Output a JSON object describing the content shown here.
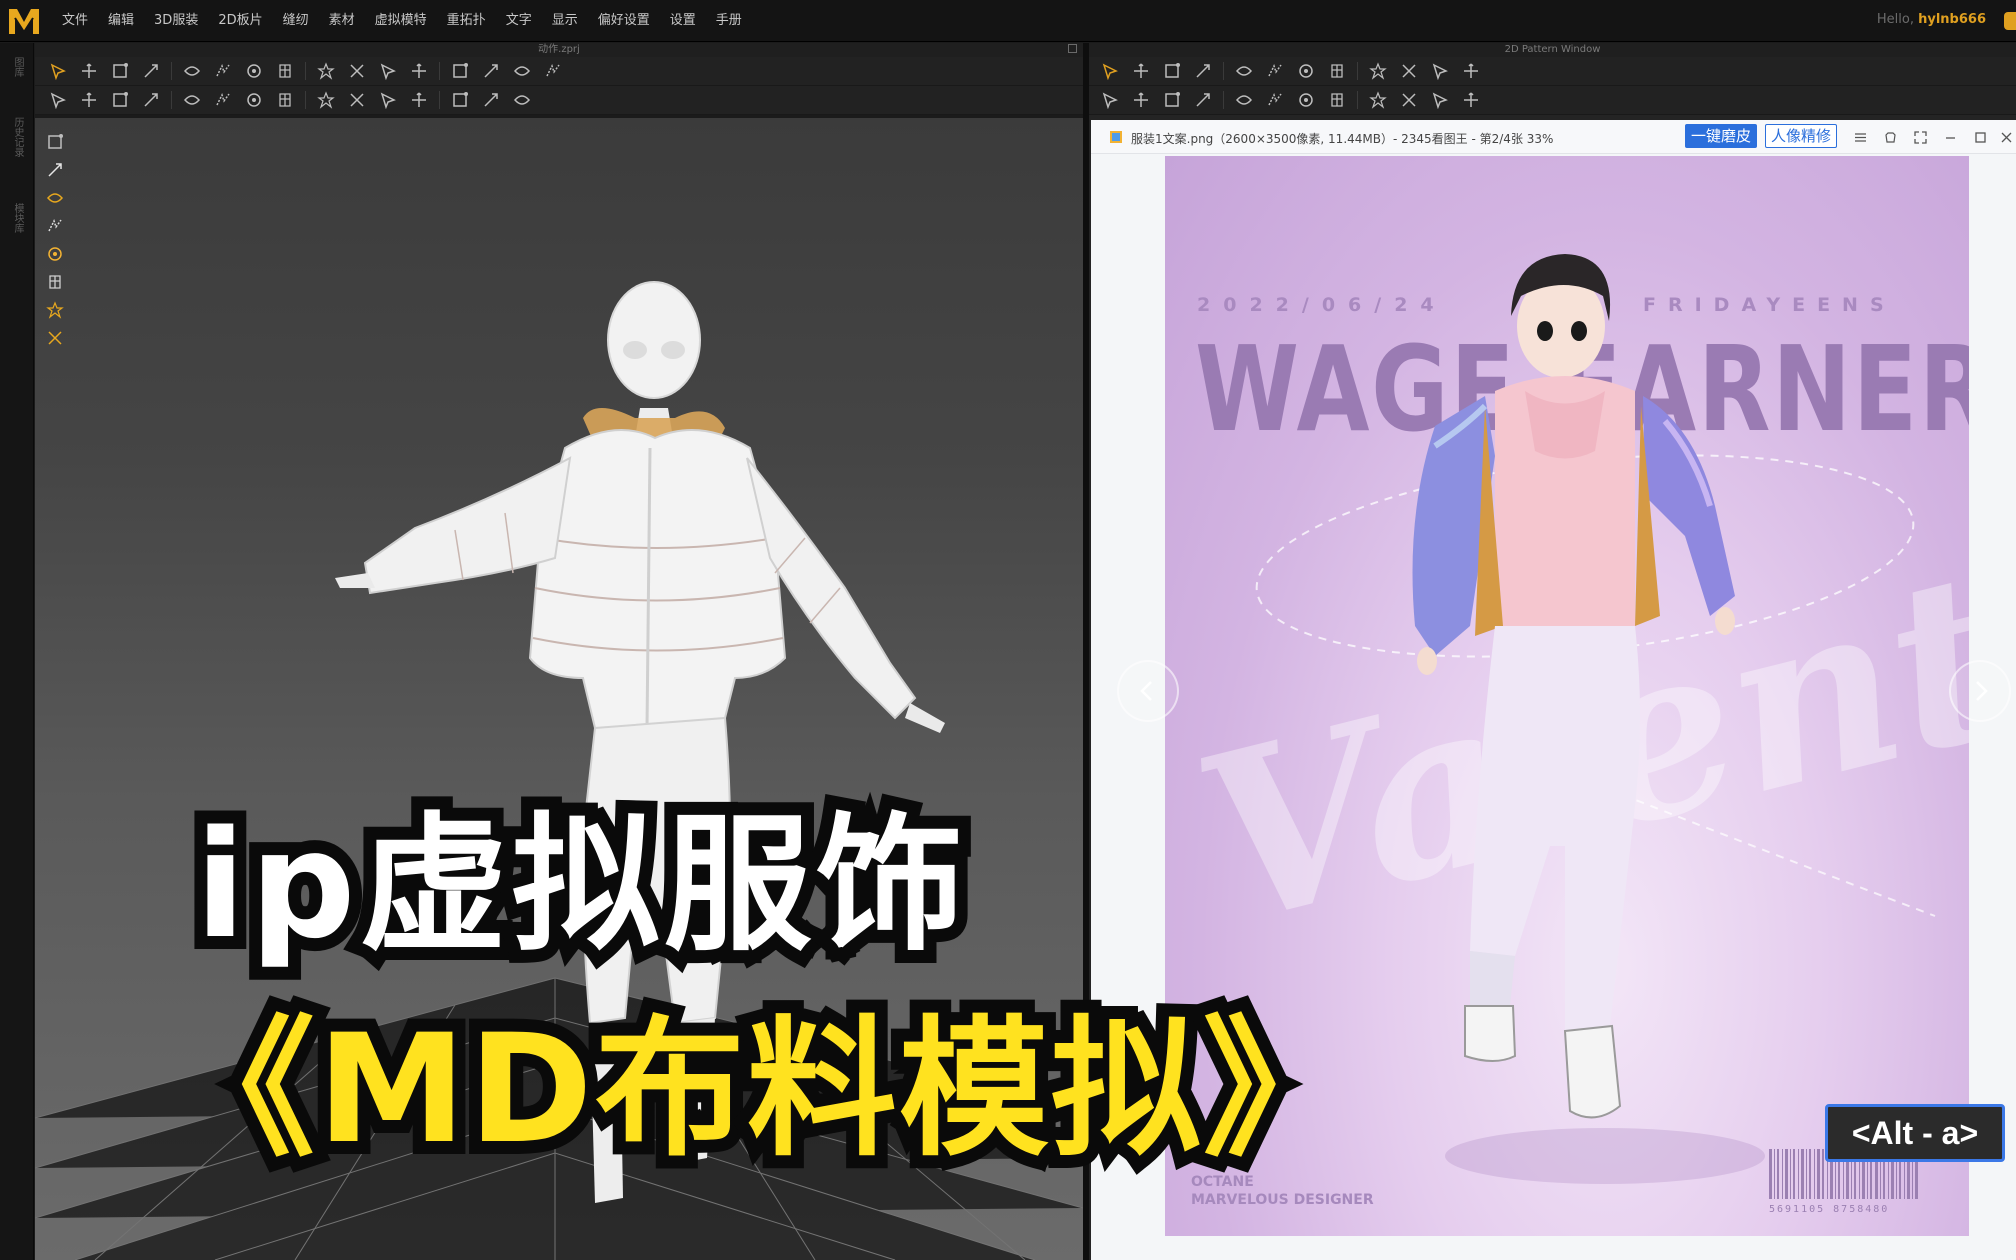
{
  "app": {
    "logo_letter": "M",
    "menu": [
      "文件",
      "编辑",
      "3D服装",
      "2D板片",
      "缝纫",
      "素材",
      "虚拟模特",
      "重拓扑",
      "文字",
      "显示",
      "偏好设置",
      "设置",
      "手册"
    ],
    "greeting_prefix": "Hello,",
    "username": "hylnb666",
    "accent_color": "#e0a020"
  },
  "left_strip": {
    "labels": [
      "图库",
      "历史记录",
      "模块库"
    ]
  },
  "window_3d": {
    "title": "动作.zprj",
    "toolbar_row1_icons": [
      "select-icon",
      "move-icon",
      "transform-icon",
      "scale-icon",
      "rotate-icon",
      "sew-icon",
      "segment-sew-icon",
      "free-sew-icon",
      "pin-icon",
      "fold-icon",
      "fold-arrange-icon",
      "tack-icon",
      "button-icon",
      "buttonhole-icon",
      "grid-icon",
      "grid2-icon"
    ],
    "toolbar_row2_icons": [
      "simulate-icon",
      "avatar-icon",
      "edit-avatar-icon",
      "measure-icon",
      "arrangement-icon",
      "texture-icon",
      "topstitch-icon",
      "zipper-icon",
      "puckering-icon",
      "elastic-icon",
      "trim-icon",
      "graphic-icon",
      "line-icon",
      "dot-icon",
      "ruler-icon"
    ]
  },
  "viewport_toolbar_icons": [
    "camera-icon",
    "garment-icon",
    "avatar-surface-icon",
    "avatar-icon",
    "texture-icon",
    "pressure-icon",
    "skin-icon",
    "globe-icon"
  ],
  "window_2d": {
    "title": "2D Pattern Window",
    "toolbar_row1_icons": [
      "transform-pattern-icon",
      "edit-pattern-icon",
      "edit-curve-icon",
      "add-point-icon",
      "polygon-icon",
      "rectangle-icon",
      "circle-icon",
      "internal-polygon-icon",
      "trace-icon",
      "grading-icon",
      "pin-icon",
      "grid-icon"
    ],
    "toolbar_row2_icons": [
      "segment-sew-icon",
      "free-sew-icon",
      "edit-sew-icon",
      "check-sew-icon",
      "tack-icon",
      "button-icon",
      "buttonhole-icon",
      "select-button-icon",
      "dart-icon",
      "fold-icon",
      "topstitch-icon",
      "zipper-icon"
    ]
  },
  "image_viewer": {
    "filename": "服装1文案.png（2600×3500像素, 11.44MB）- 2345看图王 - 第2/4张 33%",
    "btn_one_click": "一键磨皮",
    "btn_portrait": "人像精修",
    "accent_color": "#2b6fdc",
    "poster": {
      "date_line": "2022/06/24",
      "brand_line": "FRIDAYEENS",
      "headline": "WAGE-EARNERS",
      "script_text": "Valentine",
      "footer_line1": "OCTANE",
      "footer_line2": "MARVELOUS DESIGNER",
      "barcode_number": "5691105 8758480"
    }
  },
  "shortcut_badge": "<Alt - a>",
  "overlay_title": {
    "line1": "ip虚拟服饰",
    "line2": "《MD布料模拟》",
    "line1_color": "#ffffff",
    "line2_color": "#ffe21f"
  }
}
